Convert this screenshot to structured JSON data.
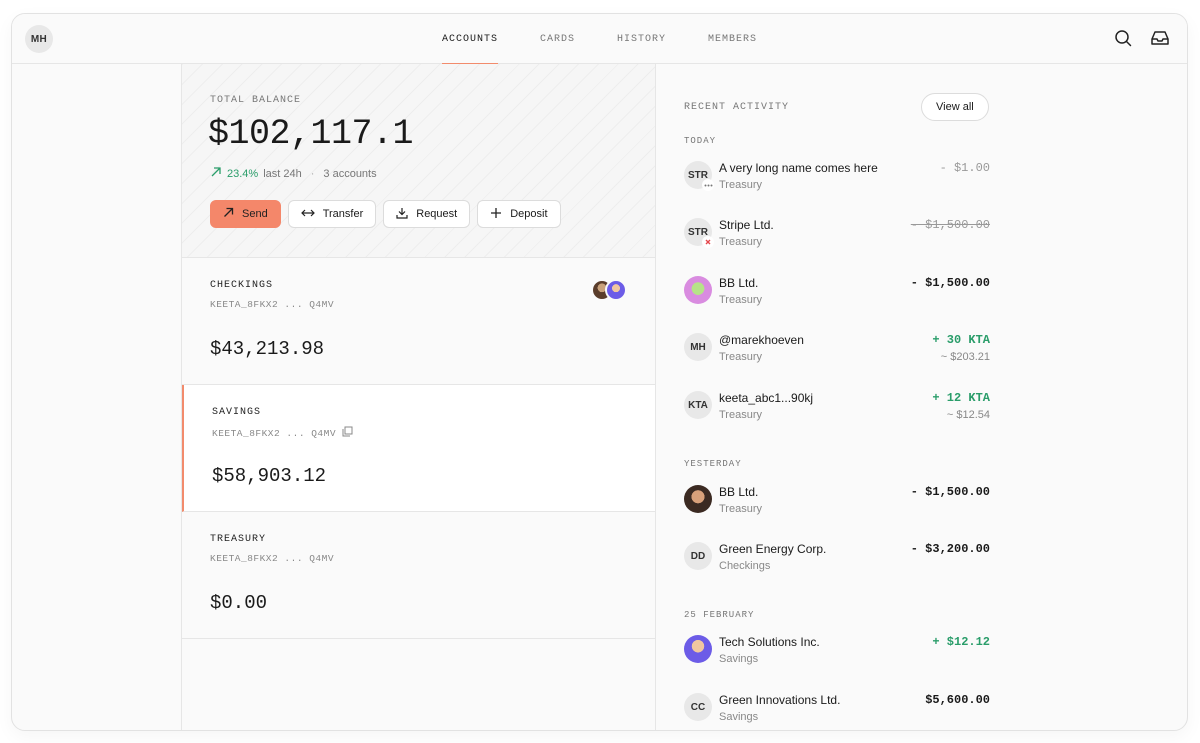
{
  "user": {
    "initials": "MH"
  },
  "nav": {
    "tabs": [
      {
        "label": "ACCOUNTS",
        "active": true
      },
      {
        "label": "CARDS",
        "active": false
      },
      {
        "label": "HISTORY",
        "active": false
      },
      {
        "label": "MEMBERS",
        "active": false
      }
    ]
  },
  "balance": {
    "label": "TOTAL BALANCE",
    "amount": "$102,117.1",
    "change_pct": "23.4%",
    "change_period": "last 24h",
    "separator": "·",
    "accounts_count": "3 accounts",
    "actions": {
      "send": "Send",
      "transfer": "Transfer",
      "request": "Request",
      "deposit": "Deposit"
    }
  },
  "accounts": [
    {
      "name": "CHECKINGS",
      "address": "KEETA_8FKX2 ... Q4MV",
      "amount": "$43,213.98"
    },
    {
      "name": "SAVINGS",
      "address": "KEETA_8FKX2 ... Q4MV",
      "amount": "$58,903.12"
    },
    {
      "name": "TREASURY",
      "address": "KEETA_8FKX2 ... Q4MV",
      "amount": "$0.00"
    }
  ],
  "activity": {
    "label": "RECENT ACTIVITY",
    "view_all": "View all",
    "groups": [
      {
        "label": "TODAY",
        "items": [
          {
            "avatar": "STR",
            "name": "A very long name comes here",
            "account": "Treasury",
            "amount": "- $1.00",
            "sub": ""
          },
          {
            "avatar": "STR",
            "name": "Stripe Ltd.",
            "account": "Treasury",
            "amount": "- $1,500.00",
            "sub": ""
          },
          {
            "avatar": "",
            "name": "BB Ltd.",
            "account": "Treasury",
            "amount": "- $1,500.00",
            "sub": ""
          },
          {
            "avatar": "MH",
            "name": "@marekhoeven",
            "account": "Treasury",
            "amount": "+ 30 KTA",
            "sub": "~ $203.21"
          },
          {
            "avatar": "KTA",
            "name": "keeta_abc1...90kj",
            "account": "Treasury",
            "amount": "+ 12 KTA",
            "sub": "~ $12.54"
          }
        ]
      },
      {
        "label": "YESTERDAY",
        "items": [
          {
            "avatar": "",
            "name": "BB Ltd.",
            "account": "Treasury",
            "amount": "- $1,500.00",
            "sub": ""
          },
          {
            "avatar": "DD",
            "name": "Green Energy Corp.",
            "account": "Checkings",
            "amount": "- $3,200.00",
            "sub": ""
          }
        ]
      },
      {
        "label": "25 FEBRUARY",
        "items": [
          {
            "avatar": "",
            "name": "Tech Solutions Inc.",
            "account": "Savings",
            "amount": "+ $12.12",
            "sub": ""
          },
          {
            "avatar": "CC",
            "name": "Green Innovations Ltd.",
            "account": "Savings",
            "amount": "$5,600.00",
            "sub": ""
          }
        ]
      }
    ]
  },
  "colors": {
    "accent": "#f4876a",
    "positive": "#2a9d6a",
    "muted": "#888888"
  }
}
